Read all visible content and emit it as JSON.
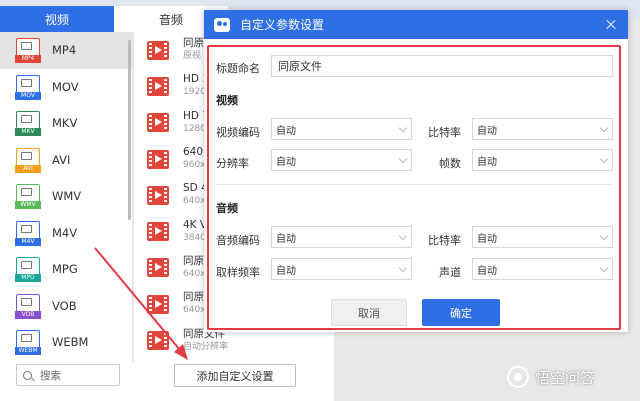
{
  "tabs": [
    {
      "label": "视频"
    },
    {
      "label": "音频"
    }
  ],
  "formats": [
    {
      "label": "MP4",
      "tag": "MP4",
      "color": "#e0473a"
    },
    {
      "label": "MOV",
      "tag": "MOV",
      "color": "#2f6fe6"
    },
    {
      "label": "MKV",
      "tag": "MKV",
      "color": "#2e8b57"
    },
    {
      "label": "AVI",
      "tag": "AVI",
      "color": "#f0a020"
    },
    {
      "label": "WMV",
      "tag": "WMV",
      "color": "#5cb85c"
    },
    {
      "label": "M4V",
      "tag": "M4V",
      "color": "#2f6fe6"
    },
    {
      "label": "MPG",
      "tag": "MPG",
      "color": "#1aa89c"
    },
    {
      "label": "VOB",
      "tag": "VOB",
      "color": "#8a4fd0"
    },
    {
      "label": "WEBM",
      "tag": "WEBM",
      "color": "#2f6fe6"
    }
  ],
  "presets": [
    {
      "name": "同原",
      "sub": "原视"
    },
    {
      "name": "HD 1",
      "sub": "1920"
    },
    {
      "name": "HD 7",
      "sub": "1280"
    },
    {
      "name": "640P",
      "sub": "960x"
    },
    {
      "name": "SD 4",
      "sub": "640x"
    },
    {
      "name": "4K V",
      "sub": "3840"
    },
    {
      "name": "同原",
      "sub": "640x"
    },
    {
      "name": "同原",
      "sub": "640x"
    },
    {
      "name": "同原文件",
      "sub": "自动分辨率"
    }
  ],
  "search": {
    "placeholder": "搜索"
  },
  "add_custom_label": "添加自定义设置",
  "dialog": {
    "title": "自定义参数设置",
    "name_label": "标题命名",
    "name_value": "同原文件",
    "video_section": "视频",
    "video_codec_label": "视频编码",
    "video_codec_value": "自动",
    "bitrate_label": "比特率",
    "bitrate_value": "自动",
    "resolution_label": "分辨率",
    "resolution_value": "自动",
    "framerate_label": "帧数",
    "framerate_value": "自动",
    "audio_section": "音频",
    "audio_codec_label": "音频编码",
    "audio_codec_value": "自动",
    "audio_bitrate_label": "比特率",
    "audio_bitrate_value": "自动",
    "sample_rate_label": "取样频率",
    "sample_rate_value": "自动",
    "channel_label": "声道",
    "channel_value": "自动",
    "cancel_label": "取消",
    "ok_label": "确定"
  },
  "watermark": "悟空问答",
  "colors": {
    "accent": "#2f6fe6",
    "highlight": "#e53945"
  }
}
